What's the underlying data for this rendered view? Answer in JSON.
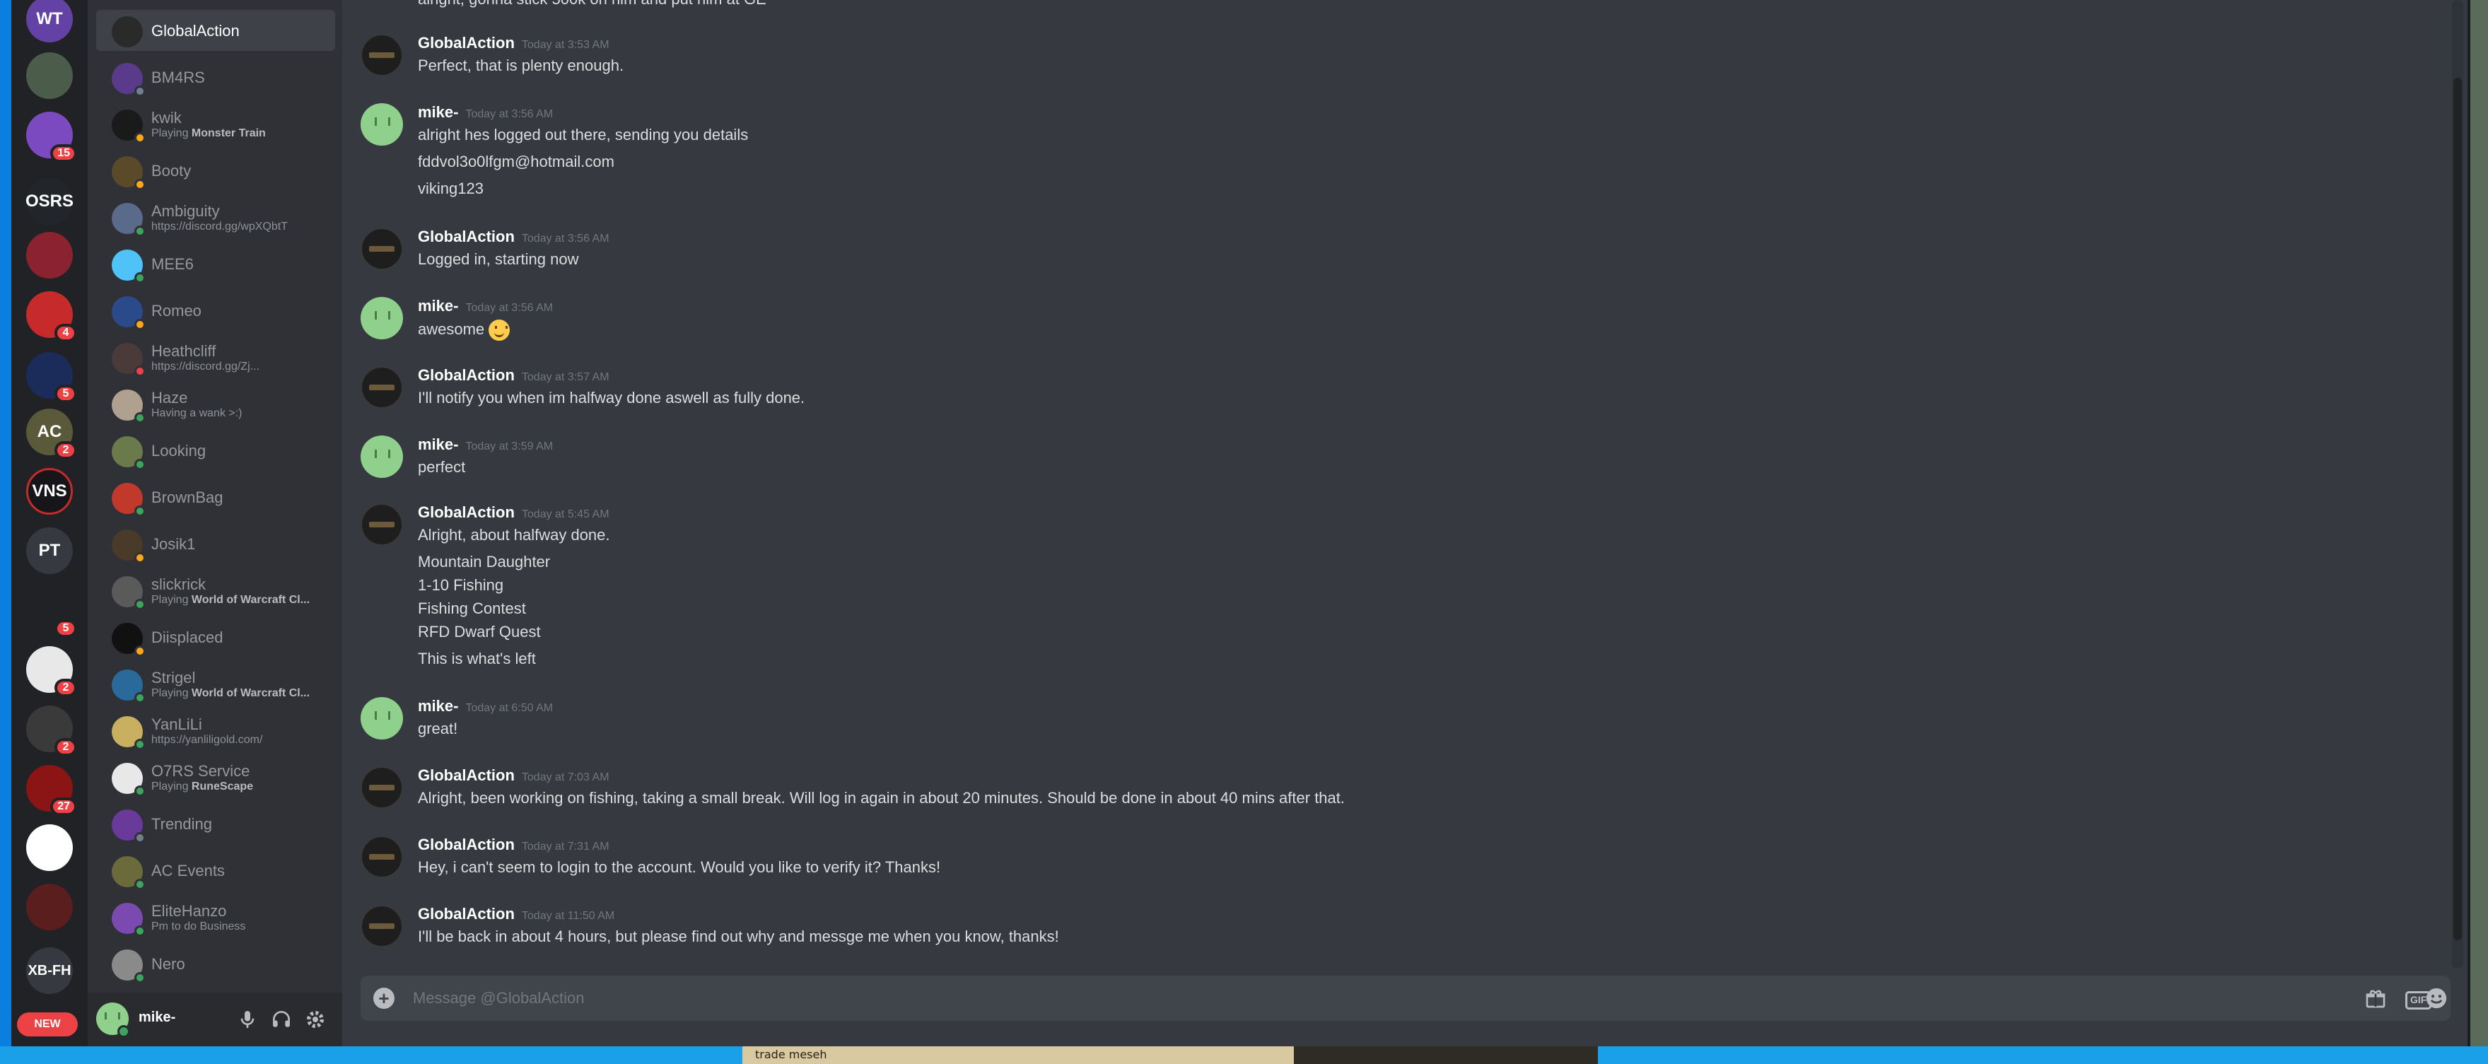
{
  "servers": [
    {
      "label": "WT",
      "color": "#6441a5",
      "badge": ""
    },
    {
      "label": "",
      "color": "#4b5d4a",
      "badge": ""
    },
    {
      "label": "",
      "color": "#7b4ac0",
      "badge": "15"
    },
    {
      "label": "OSRS",
      "color": "#22262b",
      "badge": ""
    },
    {
      "label": "",
      "color": "#8a2230",
      "badge": ""
    },
    {
      "label": "",
      "color": "#c62a2a",
      "badge": "4"
    },
    {
      "label": "",
      "color": "#1b2b5a",
      "badge": "5"
    },
    {
      "label": "AC",
      "color": "#5a5a3a",
      "badge": "2"
    },
    {
      "label": "VNS",
      "color": "#15151a",
      "badge": ""
    },
    {
      "label": "PT",
      "color": "#36393f",
      "badge": ""
    },
    {
      "label": "",
      "color": "#202225",
      "badge": "5"
    },
    {
      "label": "",
      "color": "#e8e8e8",
      "badge": "2"
    },
    {
      "label": "",
      "color": "#3a3a3a",
      "badge": "2"
    },
    {
      "label": "",
      "color": "#8b1414",
      "badge": "27"
    },
    {
      "label": "",
      "color": "#ffffff",
      "badge": ""
    },
    {
      "label": "",
      "color": "#5a1e1e",
      "badge": ""
    },
    {
      "label": "XB-FH",
      "color": "#36393f",
      "badge": ""
    }
  ],
  "new_pill": "NEW",
  "dms": [
    {
      "name": "GlobalAction",
      "sub": "",
      "status": "none",
      "color": "#2a2a2a",
      "active": true
    },
    {
      "name": "BM4RS",
      "sub": "",
      "status": "off",
      "color": "#5a3a8a"
    },
    {
      "name": "kwik",
      "sub_pre": "Playing ",
      "sub_bold": "Monster Train",
      "status": "idle",
      "color": "#1a1a1a"
    },
    {
      "name": "Booty",
      "sub": "",
      "status": "idle",
      "color": "#5a4a2a"
    },
    {
      "name": "Ambiguity",
      "sub": "https://discord.gg/wpXQbtT",
      "status": "on",
      "color": "#5a6a8a"
    },
    {
      "name": "MEE6",
      "sub": "",
      "status": "on",
      "color": "#4fc3f7"
    },
    {
      "name": "Romeo",
      "sub": "",
      "status": "idle",
      "color": "#2a4a8a"
    },
    {
      "name": "Heathcliff",
      "sub": "https://discord.gg/Zj...",
      "status": "dnd",
      "color": "#4a3a3a"
    },
    {
      "name": "Haze",
      "sub": "Having a wank >:)",
      "status": "on",
      "color": "#b0a090"
    },
    {
      "name": "Looking",
      "sub": "",
      "status": "on",
      "color": "#6a7a4a"
    },
    {
      "name": "BrownBag",
      "sub": "",
      "status": "on",
      "color": "#c0392b"
    },
    {
      "name": "Josik1",
      "sub": "",
      "status": "idle",
      "color": "#4a3a2a"
    },
    {
      "name": "slickrick",
      "sub_pre": "Playing ",
      "sub_bold": "World of Warcraft Cl...",
      "status": "on",
      "color": "#5a5a5a"
    },
    {
      "name": "Diisplaced",
      "sub": "",
      "status": "idle",
      "color": "#111111"
    },
    {
      "name": "Strigel",
      "sub_pre": "Playing ",
      "sub_bold": "World of Warcraft Cl...",
      "status": "on",
      "color": "#2a6a9a"
    },
    {
      "name": "YanLiLi",
      "sub": "https://yanliligold.com/",
      "status": "on",
      "color": "#c8b060"
    },
    {
      "name": "O7RS Service",
      "sub_pre": "Playing ",
      "sub_bold": "RuneScape",
      "status": "on",
      "color": "#e8e8e8"
    },
    {
      "name": "Trending",
      "sub": "",
      "status": "off",
      "color": "#6a3a9a"
    },
    {
      "name": "AC Events",
      "sub": "",
      "status": "on",
      "color": "#6a6a3a"
    },
    {
      "name": "EliteHanzo",
      "sub": "Pm to do Business",
      "status": "on",
      "color": "#7a4ab0"
    },
    {
      "name": "Nero",
      "sub": "",
      "status": "on",
      "color": "#8a8a8a"
    }
  ],
  "user": {
    "name": "mike-"
  },
  "partial_top_line": "alright, gonna stick 500k on him and put him at GE",
  "messages": [
    {
      "author": "GlobalAction",
      "avatar": "ga",
      "time": "Today at 3:53 AM",
      "lines": [
        "Perfect, that is plenty enough."
      ]
    },
    {
      "author": "mike-",
      "avatar": "mk",
      "time": "Today at 3:56 AM",
      "lines": [
        "alright hes logged out there, sending you details",
        "fddvol3o0lfgm@hotmail.com",
        "viking123"
      ]
    },
    {
      "author": "GlobalAction",
      "avatar": "ga",
      "time": "Today at 3:56 AM",
      "lines": [
        "Logged in, starting now"
      ]
    },
    {
      "author": "mike-",
      "avatar": "mk",
      "time": "Today at 3:56 AM",
      "lines": [
        "awesome"
      ]
    },
    {
      "author": "GlobalAction",
      "avatar": "ga",
      "time": "Today at 3:57 AM",
      "lines": [
        "I'll notify you when im halfway done aswell as fully done."
      ]
    },
    {
      "author": "mike-",
      "avatar": "mk",
      "time": "Today at 3:59 AM",
      "lines": [
        "perfect"
      ]
    },
    {
      "author": "GlobalAction",
      "avatar": "ga",
      "time": "Today at 5:45 AM",
      "lines": [
        "Alright, about halfway done.",
        "Mountain Daughter",
        "1-10 Fishing",
        "Fishing Contest",
        "RFD Dwarf Quest",
        "This is what's left"
      ]
    },
    {
      "author": "mike-",
      "avatar": "mk",
      "time": "Today at 6:50 AM",
      "lines": [
        "great!"
      ]
    },
    {
      "author": "GlobalAction",
      "avatar": "ga",
      "time": "Today at 7:03 AM",
      "lines": [
        "Alright, been working on fishing, taking a small break. Will log in again in about 20 minutes. Should be done in about 40 mins after that."
      ]
    },
    {
      "author": "GlobalAction",
      "avatar": "ga",
      "time": "Today at 7:31 AM",
      "lines": [
        "Hey, i can't seem to login to the account. Would you like to verify it? Thanks!"
      ]
    },
    {
      "author": "GlobalAction",
      "avatar": "ga",
      "time": "Today at 11:50 AM",
      "lines": [
        "I'll be back in about 4 hours, but please find out why and messge me when you know, thanks!"
      ]
    }
  ],
  "composer": {
    "placeholder": "Message @GlobalAction",
    "gif_label": "GIF"
  },
  "background_text": "trade meseh"
}
